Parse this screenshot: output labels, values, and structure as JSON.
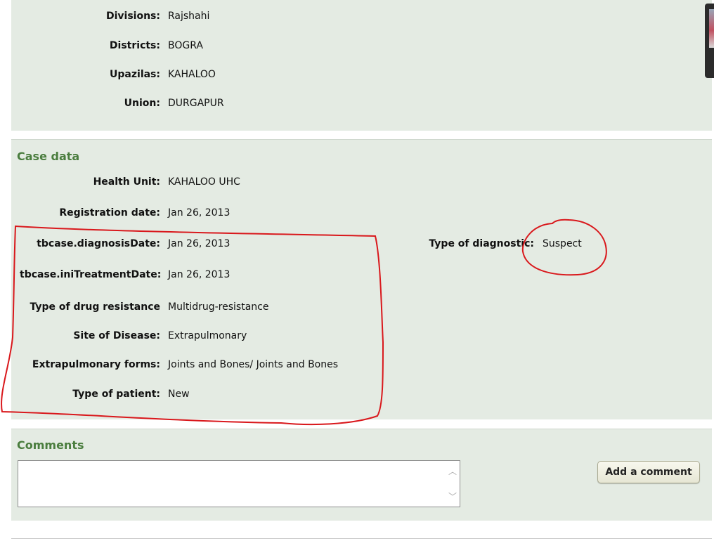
{
  "address": {
    "rows": [
      {
        "label": "Divisions:",
        "value": "Rajshahi"
      },
      {
        "label": "Districts:",
        "value": "BOGRA"
      },
      {
        "label": "Upazilas:",
        "value": "KAHALOO"
      },
      {
        "label": "Union:",
        "value": "DURGAPUR"
      }
    ]
  },
  "case": {
    "title": "Case data",
    "rows": [
      {
        "label": "Health Unit:",
        "value": "KAHALOO UHC"
      },
      {
        "label": "Registration date:",
        "value": "Jan 26, 2013"
      },
      {
        "label": "tbcase.diagnosisDate:",
        "value": "Jan 26, 2013"
      },
      {
        "label": "tbcase.iniTreatmentDate:",
        "value": "Jan 26, 2013"
      },
      {
        "label": "Type of drug resistance",
        "value": "Multidrug-resistance"
      },
      {
        "label": "Site of Disease:",
        "value": "Extrapulmonary"
      },
      {
        "label": "Extrapulmonary forms:",
        "value": "Joints and Bones/ Joints and Bones"
      },
      {
        "label": "Type of patient:",
        "value": "New"
      }
    ],
    "diagnostic": {
      "label": "Type of diagnostic:",
      "value": "Suspect"
    }
  },
  "comments": {
    "title": "Comments",
    "textarea_value": "",
    "add_button": "Add a comment"
  },
  "colors": {
    "panel_bg": "#e4ebe3",
    "section_title": "#4a7d3e",
    "annotation": "#d9181c"
  }
}
